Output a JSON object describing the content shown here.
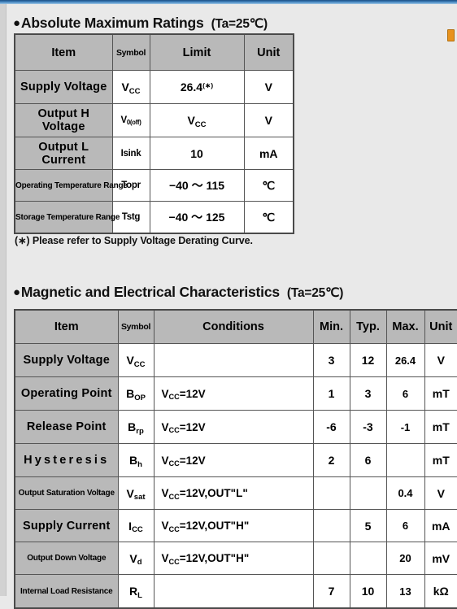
{
  "sections": {
    "absolute_max": {
      "bullet": "●",
      "title": "Absolute Maximum Ratings",
      "condition": "(Ta=25℃)",
      "columns": [
        "Item",
        "Symbol",
        "Limit",
        "Unit"
      ],
      "rows": [
        {
          "item": "Supply  Voltage",
          "symbol_base": "V",
          "symbol_sub": "CC",
          "limit": "26.4",
          "limit_star": "(∗)",
          "unit": "V"
        },
        {
          "item": "Output H Voltage",
          "symbol_base": "V",
          "symbol_sub": "0(off)",
          "limit_base": "V",
          "limit_sub": "CC",
          "unit": "V"
        },
        {
          "item": "Output L Current",
          "symbol_base": "Isink",
          "symbol_sub": "",
          "limit": "10",
          "unit": "mA"
        },
        {
          "item": "Operating  Temperature  Range",
          "symbol_base": "Topr",
          "symbol_sub": "",
          "limit": "−40 ～ 115",
          "unit": "℃"
        },
        {
          "item": "Storage Temperature Range",
          "symbol_base": "Tstg",
          "symbol_sub": "",
          "limit": "−40 ～ 125",
          "unit": "℃"
        }
      ],
      "footnote": "(∗) Please refer to Supply Voltage Derating Curve."
    },
    "magnetic_electrical": {
      "bullet": "●",
      "title": "Magnetic and Electrical Characteristics",
      "condition": "(Ta=25℃)",
      "columns": [
        "Item",
        "Symbol",
        "Conditions",
        "Min.",
        "Typ.",
        "Max.",
        "Unit"
      ],
      "rows": [
        {
          "item": "Supply  Voltage",
          "symbol_base": "V",
          "symbol_sub": "CC",
          "cond_base": "",
          "cond_sub": "",
          "cond_tail": "",
          "min": "3",
          "typ": "12",
          "max": "26.4",
          "unit": "V"
        },
        {
          "item": "Operating  Point",
          "symbol_base": "B",
          "symbol_sub": "OP",
          "cond_base": "V",
          "cond_sub": "CC",
          "cond_tail": "=12V",
          "min": "1",
          "typ": "3",
          "max": "6",
          "unit": "mT"
        },
        {
          "item": "Release  Point",
          "symbol_base": "B",
          "symbol_sub": "rp",
          "cond_base": "V",
          "cond_sub": "CC",
          "cond_tail": "=12V",
          "min": "-6",
          "typ": "-3",
          "max": "-1",
          "unit": "mT"
        },
        {
          "item": "Hysteresis",
          "symbol_base": "B",
          "symbol_sub": "h",
          "cond_base": "V",
          "cond_sub": "CC",
          "cond_tail": "=12V",
          "min": "2",
          "typ": "6",
          "max": "",
          "unit": "mT"
        },
        {
          "item": "Output Saturation Voltage",
          "symbol_base": "V",
          "symbol_sub": "sat",
          "cond_base": "V",
          "cond_sub": "CC",
          "cond_tail": "=12V,OUT\"L\"",
          "min": "",
          "typ": "",
          "max": "0.4",
          "unit": "V"
        },
        {
          "item": "Supply  Current",
          "symbol_base": "I",
          "symbol_sub": "CC",
          "cond_base": "V",
          "cond_sub": "CC",
          "cond_tail": "=12V,OUT\"H\"",
          "min": "",
          "typ": "5",
          "max": "6",
          "unit": "mA"
        },
        {
          "item": "Output  Down  Voltage",
          "symbol_base": "V",
          "symbol_sub": "d",
          "cond_base": "V",
          "cond_sub": "CC",
          "cond_tail": "=12V,OUT\"H\"",
          "min": "",
          "typ": "",
          "max": "20",
          "unit": "mV"
        },
        {
          "item": "Internal Load Resistance",
          "symbol_base": "R",
          "symbol_sub": "L",
          "cond_base": "",
          "cond_sub": "",
          "cond_tail": "",
          "min": "7",
          "typ": "10",
          "max": "13",
          "unit": "kΩ"
        }
      ]
    }
  },
  "colors": {
    "header_gray": "#b9b9b9",
    "page_background": "#e9e9e9",
    "border": "#555555",
    "chrome_blue": "#3f7fba",
    "marker_orange": "#e8921d"
  }
}
